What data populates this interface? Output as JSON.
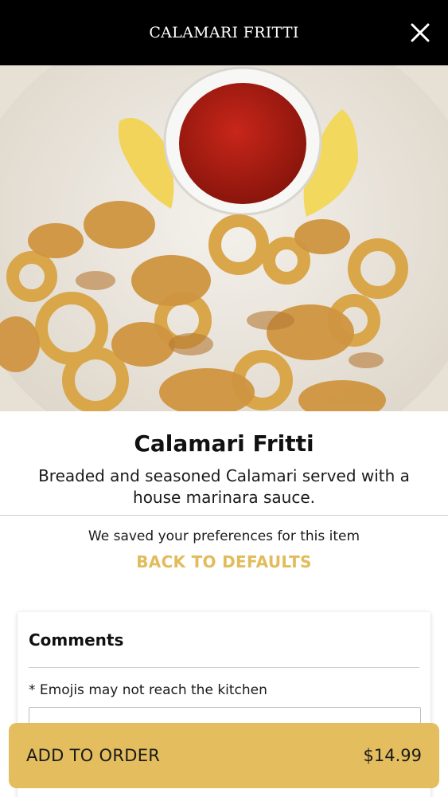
{
  "header": {
    "title": "CALAMARI FRITTI",
    "close_icon": "close-icon"
  },
  "item": {
    "image_icon": "calamari-photo",
    "name": "Calamari Fritti",
    "description": "Breaded and seasoned Calamari served with a house marinara sauce."
  },
  "preferences": {
    "saved_note": "We saved your preferences for this item",
    "reset_label": "BACK TO DEFAULTS"
  },
  "comments": {
    "title": "Comments",
    "note": "* Emojis may not reach the kitchen",
    "value": ""
  },
  "order": {
    "label": "ADD TO ORDER",
    "price": "$14.99"
  },
  "colors": {
    "header_bg": "#000000",
    "accent": "#e3bd5e",
    "link": "#e2bc5c"
  }
}
